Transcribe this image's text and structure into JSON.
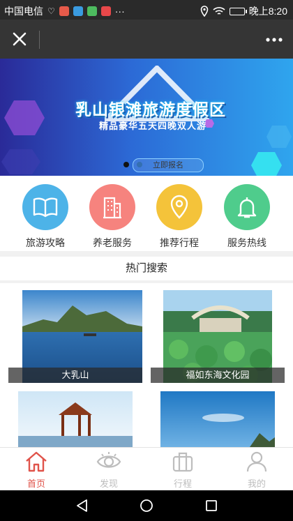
{
  "status_bar": {
    "carrier": "中国电信",
    "time": "晚上8:20",
    "more": "···",
    "icons": [
      "heart-pulse-icon",
      "app-icon",
      "app-icon",
      "app-icon",
      "app-icon",
      "location-icon",
      "wifi-icon",
      "battery-icon"
    ]
  },
  "titlebar": {
    "close_icon": "close-icon",
    "more_icon": "more-dots-icon"
  },
  "banner": {
    "title": "乳山银滩旅游度假区",
    "subtitle": "精品豪华五天四晚双人游",
    "button": "立即报名",
    "page_count": 2,
    "active_page": 1
  },
  "categories": [
    {
      "label": "旅游攻略",
      "icon": "book-icon",
      "color": "#4db3e8"
    },
    {
      "label": "养老服务",
      "icon": "building-icon",
      "color": "#f6837e"
    },
    {
      "label": "推荐行程",
      "icon": "location-pin-icon",
      "color": "#f4c33a"
    },
    {
      "label": "服务热线",
      "icon": "bell-icon",
      "color": "#4fcc8c"
    }
  ],
  "hot_search": {
    "title": "热门搜索",
    "items": [
      {
        "caption": "大乳山"
      },
      {
        "caption": "福如东海文化园"
      },
      {
        "caption": ""
      },
      {
        "caption": ""
      }
    ]
  },
  "tabs": [
    {
      "label": "首页",
      "icon": "home-icon",
      "active": true
    },
    {
      "label": "发现",
      "icon": "eye-icon",
      "active": false
    },
    {
      "label": "行程",
      "icon": "luggage-icon",
      "active": false
    },
    {
      "label": "我的",
      "icon": "user-icon",
      "active": false
    }
  ],
  "colors": {
    "active_tab": "#e0534a",
    "inactive_tab": "#bdbdbd"
  }
}
